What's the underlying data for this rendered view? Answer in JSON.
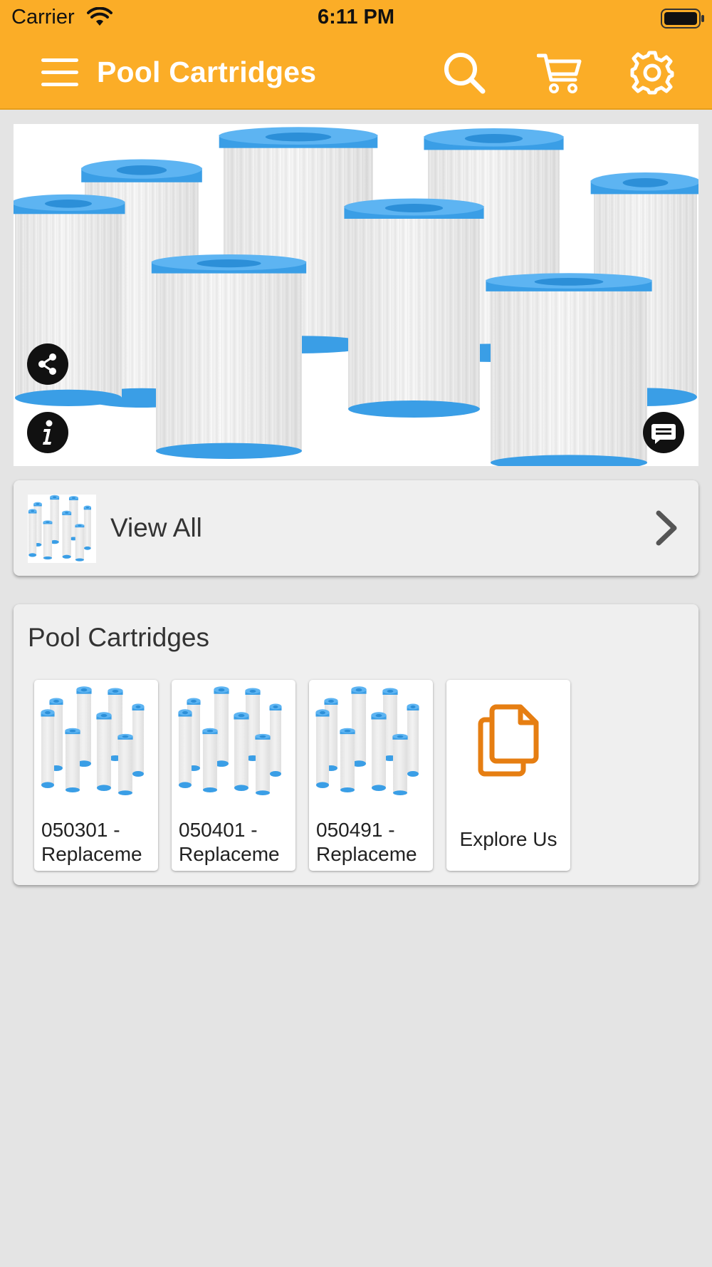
{
  "status_bar": {
    "carrier": "Carrier",
    "time": "6:11 PM"
  },
  "header": {
    "title": "Pool Cartridges",
    "color": "#fbad27"
  },
  "icons": {
    "menu": "hamburger-menu-icon",
    "search": "search-icon",
    "cart": "cart-icon",
    "settings": "gear-icon",
    "share": "share-icon",
    "info": "info-icon",
    "chat": "chat-icon",
    "chevron": "chevron-right-icon",
    "explore": "copy-documents-icon"
  },
  "view_all": {
    "label": "View All"
  },
  "section": {
    "title": "Pool Cartridges",
    "items": [
      {
        "line1": "050301 -",
        "line2": "Replaceme"
      },
      {
        "line1": "050401 -",
        "line2": "Replaceme"
      },
      {
        "line1": "050491 -",
        "line2": "Replaceme"
      }
    ],
    "explore_label": "Explore Us"
  },
  "colors": {
    "accent": "#fbad27",
    "filter_blue": "#3a9ee6",
    "explore_orange": "#e67e12"
  }
}
